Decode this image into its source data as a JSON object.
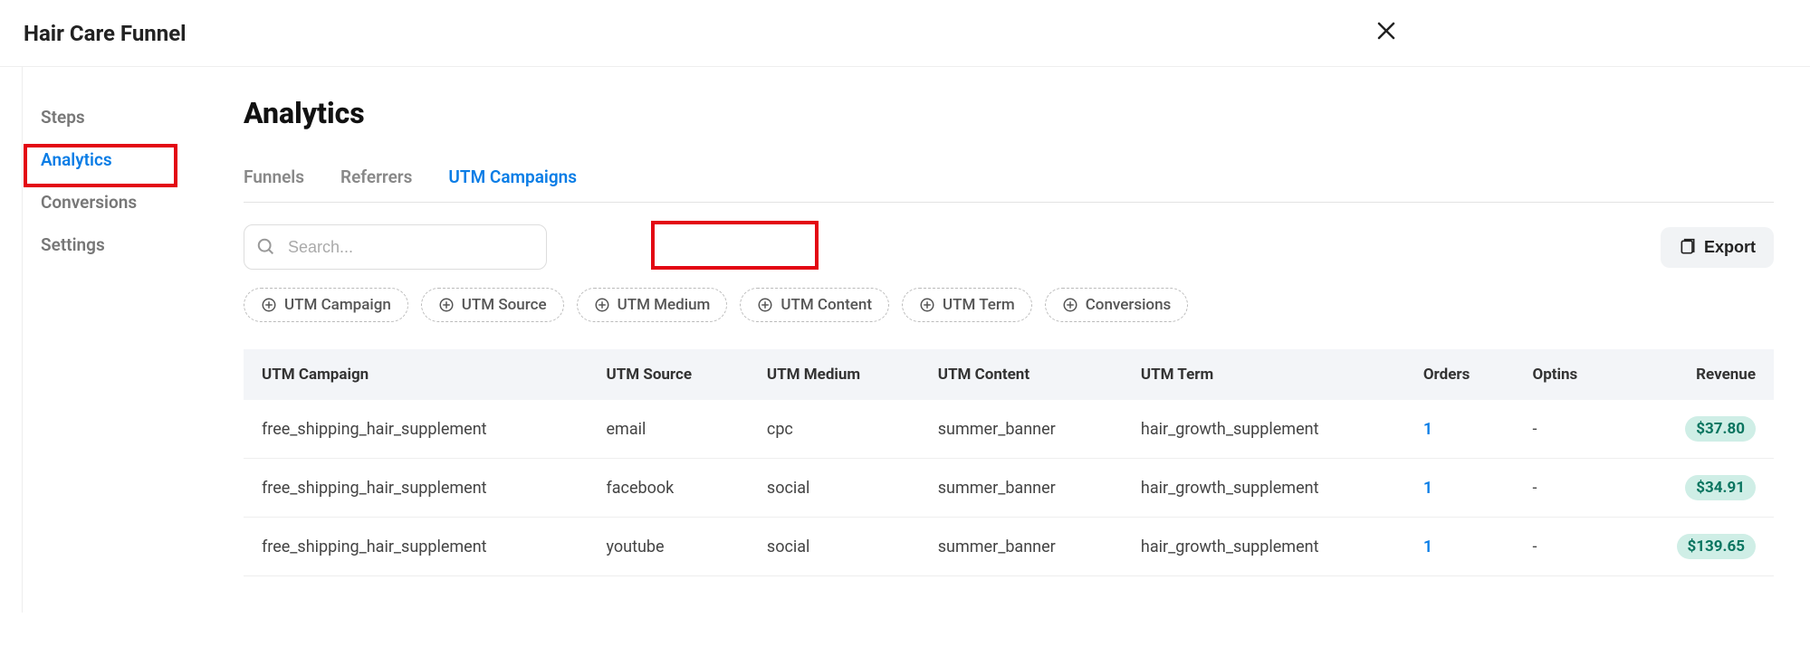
{
  "header": {
    "title": "Hair Care Funnel"
  },
  "sidebar": {
    "items": [
      {
        "label": "Steps",
        "active": false
      },
      {
        "label": "Analytics",
        "active": true
      },
      {
        "label": "Conversions",
        "active": false
      },
      {
        "label": "Settings",
        "active": false
      }
    ]
  },
  "page": {
    "title": "Analytics"
  },
  "tabs": [
    {
      "label": "Funnels",
      "active": false
    },
    {
      "label": "Referrers",
      "active": false
    },
    {
      "label": "UTM Campaigns",
      "active": true
    }
  ],
  "search": {
    "placeholder": "Search..."
  },
  "export": {
    "label": "Export"
  },
  "chips": [
    {
      "label": "UTM Campaign"
    },
    {
      "label": "UTM Source"
    },
    {
      "label": "UTM Medium"
    },
    {
      "label": "UTM Content"
    },
    {
      "label": "UTM Term"
    },
    {
      "label": "Conversions"
    }
  ],
  "table": {
    "columns": [
      {
        "label": "UTM Campaign",
        "align": "left"
      },
      {
        "label": "UTM Source",
        "align": "left"
      },
      {
        "label": "UTM Medium",
        "align": "left"
      },
      {
        "label": "UTM Content",
        "align": "left"
      },
      {
        "label": "UTM Term",
        "align": "left"
      },
      {
        "label": "Orders",
        "align": "left"
      },
      {
        "label": "Optins",
        "align": "left"
      },
      {
        "label": "Revenue",
        "align": "right"
      }
    ],
    "rows": [
      {
        "campaign": "free_shipping_hair_supplement",
        "source": "email",
        "medium": "cpc",
        "content": "summer_banner",
        "term": "hair_growth_supplement",
        "orders": "1",
        "optins": "-",
        "revenue": "$37.80"
      },
      {
        "campaign": "free_shipping_hair_supplement",
        "source": "facebook",
        "medium": "social",
        "content": "summer_banner",
        "term": "hair_growth_supplement",
        "orders": "1",
        "optins": "-",
        "revenue": "$34.91"
      },
      {
        "campaign": "free_shipping_hair_supplement",
        "source": "youtube",
        "medium": "social",
        "content": "summer_banner",
        "term": "hair_growth_supplement",
        "orders": "1",
        "optins": "-",
        "revenue": "$139.65"
      }
    ]
  }
}
